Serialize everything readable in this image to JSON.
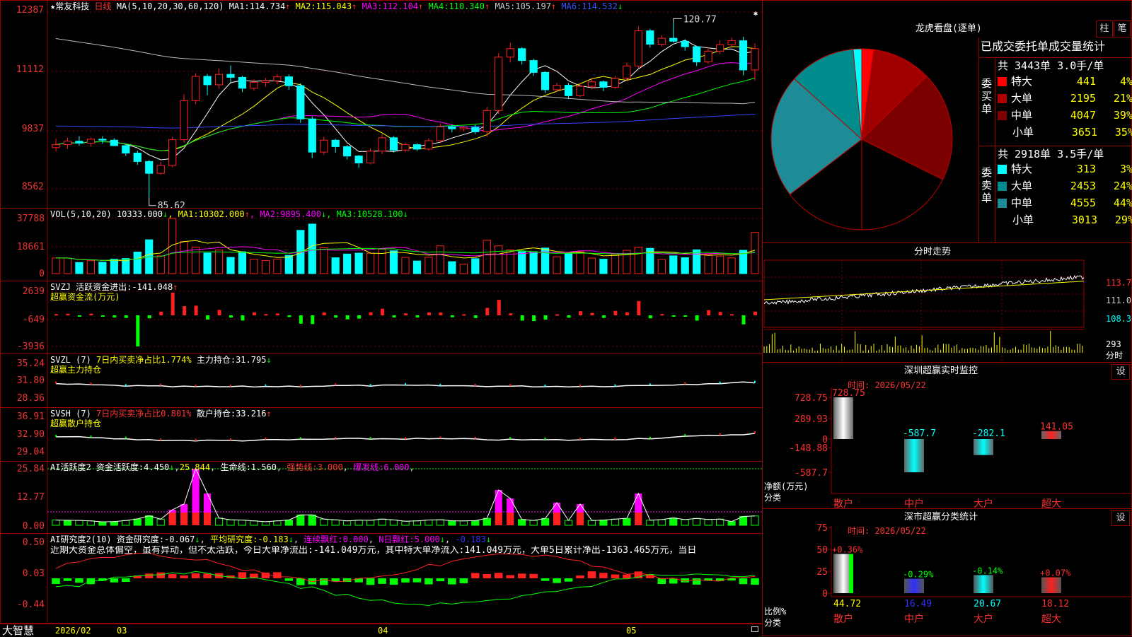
{
  "app": {
    "brand": "大智慧",
    "star": "★",
    "stock_name": "常友科技",
    "period": "日线",
    "corner_star": "✱"
  },
  "main": {
    "ma_title": "MA(5,10,20,30,60,120)",
    "ma": [
      {
        "label": "MA1:",
        "value": "114.734",
        "arrow": "↑",
        "color": "#ffffff"
      },
      {
        "label": "MA2:",
        "value": "115.043",
        "arrow": "↑",
        "color": "#ffff00"
      },
      {
        "label": "MA3:",
        "value": "112.104",
        "arrow": "↑",
        "color": "#ff00ff"
      },
      {
        "label": "MA4:",
        "value": "110.340",
        "arrow": "↑",
        "color": "#00ff00"
      },
      {
        "label": "MA5:",
        "value": "105.197",
        "arrow": "↑",
        "color": "#cccccc"
      },
      {
        "label": "MA6:",
        "value": "114.532",
        "arrow": "↓",
        "color": "#3355ff"
      }
    ],
    "y_ticks": [
      "12387",
      "11112",
      "9837",
      "8562"
    ],
    "high_label": "120.77",
    "low_label": "85.62"
  },
  "vol": {
    "title": "VOL(5,10,20)",
    "value": "10333.000",
    "value_arrow": "↓",
    "ma": [
      {
        "label": "MA1:",
        "value": "10302.000",
        "arrow": "↑",
        "color": "#ffff00"
      },
      {
        "label": "MA2:",
        "value": "9895.400",
        "arrow": "↓",
        "color": "#ff00ff"
      },
      {
        "label": "MA3:",
        "value": "10528.100",
        "arrow": "↓",
        "color": "#00ff00"
      }
    ],
    "y_ticks": [
      "37788",
      "18661",
      "0"
    ]
  },
  "svzj": {
    "title": "SVZJ",
    "label": "活跃资金进出:",
    "value": "-141.048",
    "arrow": "↑",
    "sub": "超赢资金流(万元)",
    "y_ticks": [
      "2639",
      "-649",
      "-3936"
    ]
  },
  "svzl": {
    "title": "SVZL (7)",
    "desc": "7日内买卖净占比1.774%",
    "label": "主力持仓:",
    "value": "31.795",
    "arrow": "↓",
    "sub": "超赢主力持仓",
    "y_ticks": [
      "35.24",
      "31.80",
      "28.36"
    ]
  },
  "svsh": {
    "title": "SVSH (7)",
    "desc": "7日内买卖净占比0.801%",
    "label": "散户持仓:",
    "value": "33.216",
    "arrow": "↑",
    "sub": "超赢散户持仓",
    "y_ticks": [
      "36.91",
      "32.90",
      "29.04"
    ]
  },
  "ai2": {
    "title": "AI活跃度2",
    "l1": "资金活跃度:",
    "v1": "4.450",
    "a1": "↓",
    "v2": "25.844",
    "l3": "生命线:",
    "v3": "1.560",
    "l4": "强势线:",
    "v4": "3.000",
    "l5": "爆发线:",
    "v5": "6.000",
    "y_ticks": [
      "25.84",
      "12.77",
      "0.00"
    ]
  },
  "ai_res": {
    "title": "AI研究度2(10)",
    "l1": "资金研究度:",
    "v1": "-0.067",
    "a1": "↓",
    "l2": "平均研究度:",
    "v2": "-0.183",
    "a2": "↓",
    "l3": "连续飘红:",
    "v3": "0.000",
    "l4": "N日飘红:",
    "v4": "5.000",
    "a4": "↓",
    "v5": "-0.183",
    "a5": "↓",
    "note": "近期大资金总体偏空，虽有异动，但不太活跃，今日大单净流出:-141.049万元，其中特大单净流入:141.049万元，大单5日累计净出-1363.465万元，当日",
    "y_ticks": [
      "0.50",
      "0.03",
      "-0.44"
    ]
  },
  "x_axis": {
    "labels": [
      "2026/02",
      "03",
      "04",
      "05"
    ]
  },
  "dragon": {
    "title": "龙虎看盘(逐单)",
    "btn_col": "柱",
    "btn_bi": "笔",
    "table_title": "已成交委托单成交量统计",
    "buy_side": "委买单",
    "sell_side": "委卖单",
    "buy_total": "共 3443单 3.0手/单",
    "sell_total": "共 2918单 3.5手/单",
    "buy_rows": [
      {
        "name": "特大",
        "count": "441",
        "pct": "4%",
        "color": "#ff0000"
      },
      {
        "name": "大单",
        "count": "2195",
        "pct": "21%",
        "color": "#b00000"
      },
      {
        "name": "中单",
        "count": "4047",
        "pct": "39%",
        "color": "#800000"
      },
      {
        "name": "小单",
        "count": "3651",
        "pct": "35%",
        "color": "#000000"
      }
    ],
    "sell_rows": [
      {
        "name": "特大",
        "count": "313",
        "pct": "3%",
        "color": "#00ffff"
      },
      {
        "name": "大单",
        "count": "2453",
        "pct": "24%",
        "color": "#008c8c"
      },
      {
        "name": "中单",
        "count": "4555",
        "pct": "44%",
        "color": "#1e8c96"
      },
      {
        "name": "小单",
        "count": "3013",
        "pct": "29%",
        "color": "#000000"
      }
    ]
  },
  "intraday": {
    "title": "分时走势",
    "y_ticks": [
      "113.7",
      "111.0",
      "108.3"
    ],
    "vol_tick": "293",
    "vol_label": "分时"
  },
  "sz_monitor": {
    "title": "深圳超赢实时监控",
    "btn": "设",
    "time": "时间: 2026/05/22",
    "y_ticks": [
      "728.75",
      "289.93",
      "0",
      "-148.88",
      "-587.7"
    ],
    "ylabel": "净额(万元)",
    "xlabel": "分类"
  },
  "sz_stats": {
    "title": "深市超赢分类统计",
    "btn": "设",
    "time": "时间: 2026/05/22",
    "y_ticks": [
      "75",
      "50",
      "25",
      "0"
    ],
    "ylabel": "比例%",
    "xlabel": "分类"
  },
  "colors": {
    "up": "#ff2020",
    "down": "#00ffff",
    "grid": "#9b0000",
    "axis_text": "#ff3030"
  },
  "chart_data": [
    {
      "type": "pie",
      "title": "龙虎看盘(逐单)",
      "categories": [
        "特大(买)",
        "大单(买)",
        "中单(买)",
        "小单(买)",
        "小单(卖)",
        "中单(卖)",
        "大单(卖)",
        "特大(卖)"
      ],
      "values": [
        441,
        2195,
        4047,
        3651,
        3013,
        4555,
        2453,
        313
      ],
      "colors": [
        "#ff0000",
        "#a00000",
        "#7a0000",
        "#000000",
        "#000000",
        "#1e8c96",
        "#008c8c",
        "#00ffff"
      ]
    },
    {
      "type": "bar",
      "title": "深圳超赢实时监控",
      "categories": [
        "散户",
        "中户",
        "大户",
        "超大"
      ],
      "values": [
        728.75,
        -587.7,
        -282.1,
        141.05
      ],
      "value_labels": [
        "728.75",
        "-587.7",
        "-282.1",
        "141.05"
      ],
      "colors": [
        "#ffffff",
        "#00ffff",
        "#00ffff",
        "#ff2020"
      ],
      "ylim": [
        -587.7,
        728.75
      ],
      "ylabel": "净额(万元)",
      "xlabel": "分类"
    },
    {
      "type": "bar",
      "title": "深市超赢分类统计",
      "categories": [
        "散户",
        "中户",
        "大户",
        "超大"
      ],
      "values": [
        44.72,
        16.49,
        20.67,
        18.12
      ],
      "change_labels": [
        "+0.36%",
        "-0.29%",
        "-0.14%",
        "+0.07%"
      ],
      "colors": [
        "#ffffff",
        "#3030ff",
        "#00ffff",
        "#ff2020"
      ],
      "ylim": [
        0,
        75
      ],
      "ylabel": "比例%",
      "xlabel": "分类"
    },
    {
      "type": "line",
      "title": "日线",
      "y_range": [
        85,
        123
      ],
      "candles_ohlc": [
        [
          95.6,
          97.4,
          94.8,
          96.2
        ],
        [
          96.2,
          97.6,
          95.3,
          96.9
        ],
        [
          96.9,
          97.9,
          96.0,
          96.5
        ],
        [
          96.5,
          97.7,
          95.8,
          97.3
        ],
        [
          97.3,
          97.9,
          96.4,
          97.1
        ],
        [
          97.1,
          97.5,
          95.9,
          96.0
        ],
        [
          96.0,
          96.3,
          93.9,
          94.5
        ],
        [
          94.5,
          95.0,
          92.1,
          92.8
        ],
        [
          92.8,
          93.1,
          85.6,
          90.4
        ],
        [
          90.4,
          92.7,
          90.1,
          92.0
        ],
        [
          92.0,
          97.8,
          91.6,
          97.2
        ],
        [
          97.2,
          106.4,
          96.6,
          105.1
        ],
        [
          105.1,
          110.6,
          104.4,
          110.0
        ],
        [
          110.0,
          110.5,
          106.2,
          108.3
        ],
        [
          108.3,
          111.6,
          107.5,
          110.4
        ],
        [
          110.4,
          112.2,
          108.8,
          109.8
        ],
        [
          109.8,
          110.1,
          106.8,
          107.6
        ],
        [
          107.6,
          109.4,
          107.1,
          108.8
        ],
        [
          108.8,
          109.7,
          107.9,
          109.1
        ],
        [
          109.1,
          110.4,
          108.4,
          109.9
        ],
        [
          109.9,
          110.4,
          107.3,
          108.1
        ],
        [
          108.1,
          108.6,
          100.6,
          101.4
        ],
        [
          101.4,
          101.9,
          93.5,
          94.7
        ],
        [
          94.7,
          97.8,
          94.2,
          97.1
        ],
        [
          97.1,
          97.4,
          94.6,
          95.8
        ],
        [
          95.8,
          96.1,
          93.2,
          93.9
        ],
        [
          93.9,
          94.1,
          91.5,
          92.5
        ],
        [
          92.5,
          95.5,
          92.2,
          94.9
        ],
        [
          94.9,
          98.3,
          94.3,
          97.6
        ],
        [
          97.6,
          97.9,
          94.6,
          95.1
        ],
        [
          95.1,
          96.6,
          94.7,
          96.2
        ],
        [
          96.2,
          96.5,
          94.9,
          95.3
        ],
        [
          95.3,
          97.5,
          95.0,
          97.0
        ],
        [
          97.0,
          100.5,
          96.6,
          99.8
        ],
        [
          99.8,
          100.2,
          98.7,
          99.4
        ],
        [
          99.4,
          100.0,
          98.9,
          99.7
        ],
        [
          99.7,
          100.2,
          98.3,
          98.8
        ],
        [
          98.8,
          103.8,
          97.8,
          103.1
        ],
        [
          103.1,
          114.7,
          102.4,
          113.9
        ],
        [
          113.9,
          116.8,
          112.8,
          115.6
        ],
        [
          115.6,
          115.9,
          112.4,
          113.2
        ],
        [
          113.2,
          113.6,
          110.1,
          110.8
        ],
        [
          110.8,
          111.0,
          106.6,
          107.3
        ],
        [
          107.3,
          108.7,
          106.9,
          108.2
        ],
        [
          108.2,
          108.7,
          105.4,
          106.1
        ],
        [
          106.1,
          108.6,
          105.8,
          108.0
        ],
        [
          108.0,
          109.7,
          107.4,
          108.9
        ],
        [
          108.9,
          109.2,
          107.0,
          107.8
        ],
        [
          107.8,
          110.1,
          107.5,
          109.6
        ],
        [
          109.6,
          112.8,
          109.0,
          112.1
        ],
        [
          112.1,
          120.1,
          111.6,
          119.2
        ],
        [
          119.2,
          119.6,
          115.8,
          116.5
        ],
        [
          116.5,
          118.3,
          116.0,
          117.7
        ],
        [
          117.7,
          120.8,
          116.8,
          117.1
        ],
        [
          117.1,
          117.5,
          115.2,
          116.0
        ],
        [
          116.0,
          116.2,
          112.1,
          112.9
        ],
        [
          112.9,
          115.8,
          112.5,
          115.1
        ],
        [
          115.1,
          117.3,
          114.5,
          116.4
        ],
        [
          116.4,
          117.8,
          115.8,
          117.2
        ],
        [
          117.2,
          118.0,
          110.2,
          111.3
        ],
        [
          111.3,
          116.7,
          109.1,
          115.6
        ]
      ]
    }
  ]
}
